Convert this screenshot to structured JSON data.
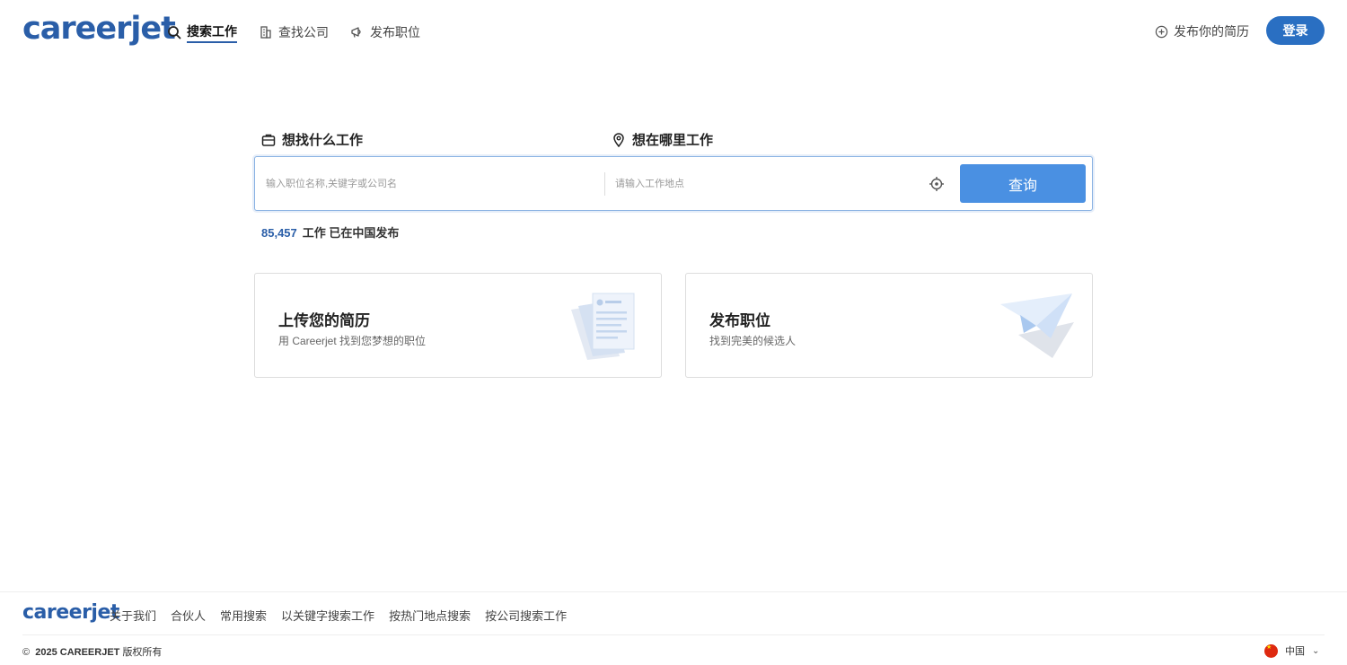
{
  "header": {
    "logo": "careerjet",
    "nav": [
      {
        "label": "搜索工作",
        "icon": "search-icon",
        "active": true
      },
      {
        "label": "查找公司",
        "icon": "building-icon",
        "active": false
      },
      {
        "label": "发布职位",
        "icon": "megaphone-icon",
        "active": false
      }
    ],
    "post_cv": "发布你的简历",
    "login": "登录"
  },
  "search": {
    "what_label": "想找什么工作",
    "where_label": "想在哪里工作",
    "what_placeholder": "输入职位名称,关键字或公司名",
    "where_placeholder": "请输入工作地点",
    "what_value": "",
    "where_value": "",
    "button": "查询"
  },
  "stats": {
    "count": "85,457",
    "text": "工作 已在中国发布"
  },
  "cards": [
    {
      "title": "上传您的简历",
      "subtitle": "用 Careerjet 找到您梦想的职位",
      "icon": "resume-documents-icon"
    },
    {
      "title": "发布职位",
      "subtitle": "找到完美的候选人",
      "icon": "paper-plane-icon"
    }
  ],
  "footer": {
    "logo": "careerjet",
    "links": [
      "关于我们",
      "合伙人",
      "常用搜索",
      "以关键字搜索工作",
      "按热门地点搜索",
      "按公司搜索工作"
    ],
    "copyright_year": "2025 CAREERJET",
    "copyright_suffix": "版权所有",
    "country": "中国"
  },
  "colors": {
    "brand": "#2a5ea8",
    "button": "#4a90e2",
    "login": "#2a6fc2"
  }
}
